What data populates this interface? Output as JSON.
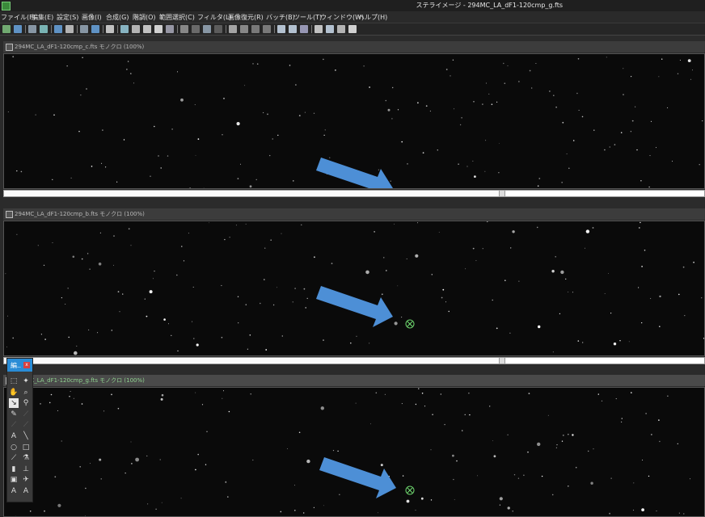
{
  "window": {
    "title": "ステライメージ - 294MC_LA_dF1-120cmp_g.fts"
  },
  "menu": [
    "ファイル(F)",
    "編集(E)",
    "設定(S)",
    "画像(I)",
    "合成(G)",
    "階調(O)",
    "範囲選択(C)",
    "フィルタ(L)",
    "画像復元(R)",
    "バッチ(B)",
    "ツール(T)",
    "ウィンドウ(W)",
    "ヘルプ(H)"
  ],
  "toolbar_icons": [
    "open-icon",
    "save-icon",
    "save-all-icon",
    "histogram-icon",
    "levels-icon",
    "curves-icon",
    "compose-icon",
    "info-icon",
    "stack-icon",
    "align-icon",
    "split-icon",
    "merge-icon",
    "crop-icon",
    "resize-icon",
    "grid-icon",
    "mosaic-icon",
    "tile-icon",
    "dot-icon",
    "level-adjust-icon",
    "tone-icon",
    "gradient-icon",
    "sphere-icon",
    "zoom-fit-icon",
    "zoom-in-icon",
    "zoom-out-icon",
    "rotate-icon",
    "measure-icon",
    "flip-icon",
    "star-icon"
  ],
  "windows": [
    {
      "title": "294MC_LA_dF1-120cmp_c.fts モノクロ (100%)",
      "active": false
    },
    {
      "title": "294MC_LA_dF1-120cmp_b.fts モノクロ (100%)",
      "active": false
    },
    {
      "title": "294MC_LA_dF1-120cmp_g.fts モノクロ (100%)",
      "active": true
    }
  ],
  "tool_palette": {
    "title": "編..",
    "close": "x",
    "tools": [
      {
        "name": "select-rect-icon",
        "glyph": "⬚"
      },
      {
        "name": "magic-wand-icon",
        "glyph": "✦"
      },
      {
        "name": "hand-icon",
        "glyph": "✋"
      },
      {
        "name": "zoom-icon",
        "glyph": "⌕"
      },
      {
        "name": "pointer-icon",
        "glyph": "↘",
        "selected": true
      },
      {
        "name": "eyedropper-icon",
        "glyph": "⚲"
      },
      {
        "name": "edit-icon",
        "glyph": "✎"
      },
      {
        "name": "line-dim-icon",
        "glyph": "⟋",
        "dim": true
      },
      {
        "name": "brush-dim-icon",
        "glyph": "⟋",
        "dim": true
      },
      {
        "name": "pen-dim-icon",
        "glyph": "⟋",
        "dim": true
      },
      {
        "name": "text-icon",
        "glyph": "A"
      },
      {
        "name": "line-icon",
        "glyph": "╲"
      },
      {
        "name": "ellipse-icon",
        "glyph": "○"
      },
      {
        "name": "rectangle-icon",
        "glyph": "□"
      },
      {
        "name": "pencil-icon",
        "glyph": "⟋"
      },
      {
        "name": "fill-icon",
        "glyph": "⚗"
      },
      {
        "name": "gradient-tool-icon",
        "glyph": "▮"
      },
      {
        "name": "stamp-icon",
        "glyph": "⊥"
      },
      {
        "name": "image-icon",
        "glyph": "▣"
      },
      {
        "name": "airplane-icon",
        "glyph": "✈"
      },
      {
        "name": "text-box-icon",
        "glyph": "A"
      },
      {
        "name": "text-outline-icon",
        "glyph": "A"
      }
    ]
  }
}
